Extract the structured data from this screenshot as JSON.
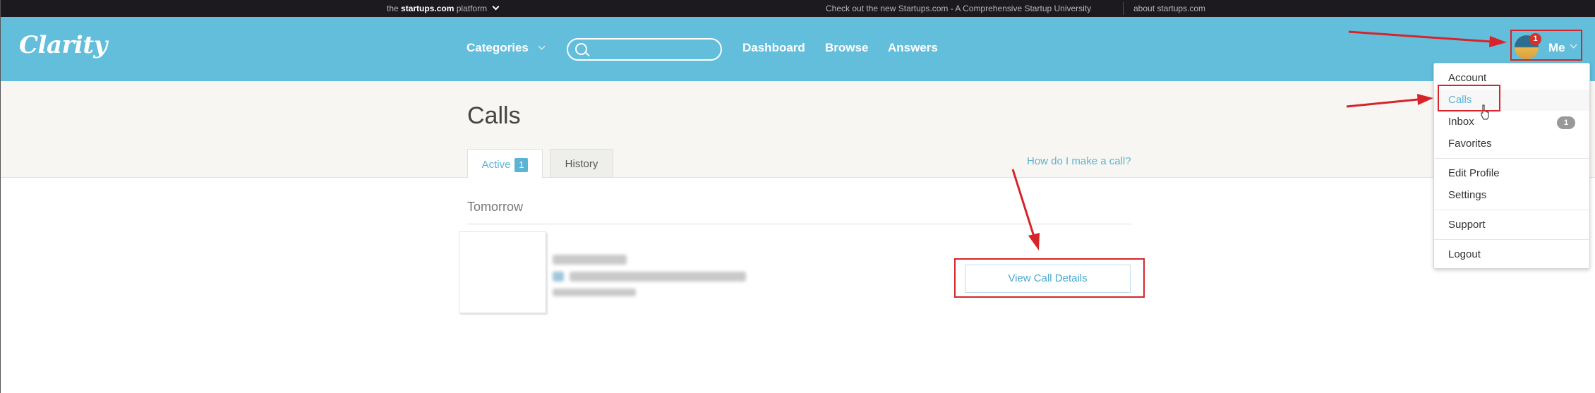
{
  "topbar": {
    "platform_prefix": "the",
    "platform_brand": "startups.com",
    "platform_suffix": "platform",
    "promo": "Check out the new Startups.com - A Comprehensive Startup University",
    "about": "about startups.com"
  },
  "header": {
    "logo": "Clarity",
    "categories": "Categories",
    "search_value": "",
    "nav": [
      "Dashboard",
      "Browse",
      "Answers"
    ],
    "me_label": "Me",
    "notification_count": "1"
  },
  "main": {
    "title": "Calls",
    "tabs": [
      {
        "label": "Active",
        "count": "1"
      },
      {
        "label": "History"
      }
    ],
    "help_link": "How do I make a call?",
    "section": "Tomorrow",
    "view_button": "View Call Details"
  },
  "dropdown": {
    "items": [
      "Account",
      "Calls",
      "Inbox",
      "Favorites",
      "Edit Profile",
      "Settings",
      "Support",
      "Logout"
    ],
    "inbox_badge": "1",
    "active_item": "Calls"
  },
  "colors": {
    "header": "#62bedb",
    "accent": "#5bb4d4",
    "annotation": "#d6242a",
    "topbar": "#1c1a1f"
  },
  "icons": [
    "search-icon",
    "chevron-down-icon",
    "cursor-hand-icon"
  ]
}
